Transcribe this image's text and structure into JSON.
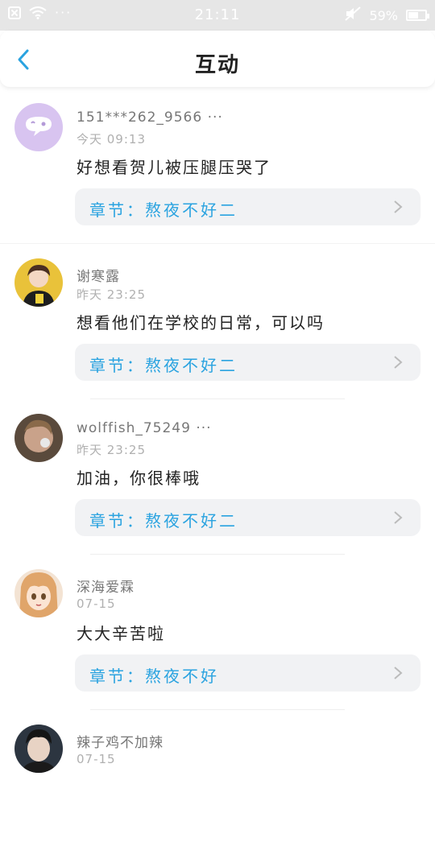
{
  "status_bar": {
    "time": "21:11",
    "battery_percent_text": "59%",
    "battery_level": 0.59,
    "icons": [
      "close-notification-icon",
      "wifi-icon",
      "more-dots-icon",
      "mute-icon",
      "battery-icon"
    ],
    "dots": "···"
  },
  "header": {
    "title": "互动",
    "back_icon": "chevron-left-icon"
  },
  "colors": {
    "accent": "#2aa3e0",
    "chapter_bg": "#f1f2f4",
    "text_primary": "#222222",
    "text_secondary": "#777777",
    "text_time": "#b0b0b0"
  },
  "comments": [
    {
      "username": "151***262_9566 ···",
      "time": "今天 09:13",
      "content": "好想看贺儿被压腿压哭了",
      "chapter": "章节：熬夜不好二",
      "avatar_icon": "default-avatar-icon"
    },
    {
      "username": "谢寒露",
      "time": "昨天 23:25",
      "content": "想看他们在学校的日常，可以吗",
      "chapter": "章节：熬夜不好二",
      "avatar_icon": "user-photo-avatar"
    },
    {
      "username": "wolffish_75249 ···",
      "time": "昨天 23:25",
      "content": "加油，你很棒哦",
      "chapter": "章节：熬夜不好二",
      "avatar_icon": "user-photo-avatar"
    },
    {
      "username": "深海爱霖",
      "time": "07-15",
      "content": "大大辛苦啦",
      "chapter": "章节：熬夜不好",
      "avatar_icon": "anime-avatar"
    },
    {
      "username": "辣子鸡不加辣",
      "time": "07-15",
      "content": "",
      "chapter": "",
      "avatar_icon": "user-photo-avatar"
    }
  ]
}
